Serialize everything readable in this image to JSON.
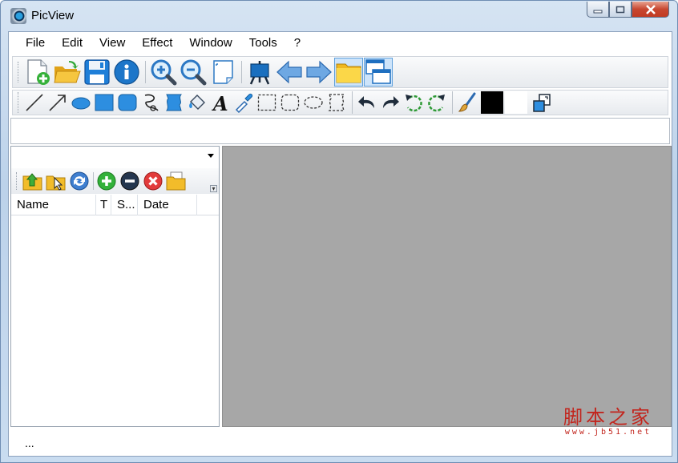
{
  "window": {
    "title": "PicView"
  },
  "menubar": {
    "items": [
      "File",
      "Edit",
      "View",
      "Effect",
      "Window",
      "Tools",
      "?"
    ]
  },
  "toolbar_main": {
    "tools": [
      "new-file-icon",
      "open-folder-icon",
      "save-icon",
      "info-icon",
      "zoom-in-icon",
      "zoom-out-icon",
      "page-icon",
      "slideshow-icon",
      "previous-arrow-icon",
      "next-arrow-icon",
      "folder-view-icon",
      "windows-icon"
    ]
  },
  "toolbar_draw": {
    "tools": [
      "line-icon",
      "arrow-line-icon",
      "ellipse-icon",
      "rectangle-icon",
      "rounded-rect-icon",
      "lasso-icon",
      "freeform-icon",
      "fill-bucket-icon",
      "text-icon",
      "eyedropper-icon",
      "rect-select-icon",
      "rounded-select-icon",
      "ellipse-select-icon",
      "freeform-select-icon",
      "undo-icon",
      "redo-icon",
      "rotate-left-icon",
      "rotate-right-icon",
      "brush-icon"
    ],
    "foreground_color": "#000000",
    "background_color": "#ffffff"
  },
  "address": {
    "value": ""
  },
  "file_browser": {
    "folder_value": "",
    "columns": [
      "Name",
      "T",
      "S...",
      "Date"
    ]
  },
  "status": {
    "text": "..."
  },
  "watermark": {
    "chinese": "脚本之家",
    "url": "www.jb51.net"
  },
  "colors": {
    "viewer_bg": "#a7a7a7",
    "accent": "#1e7fd6"
  }
}
